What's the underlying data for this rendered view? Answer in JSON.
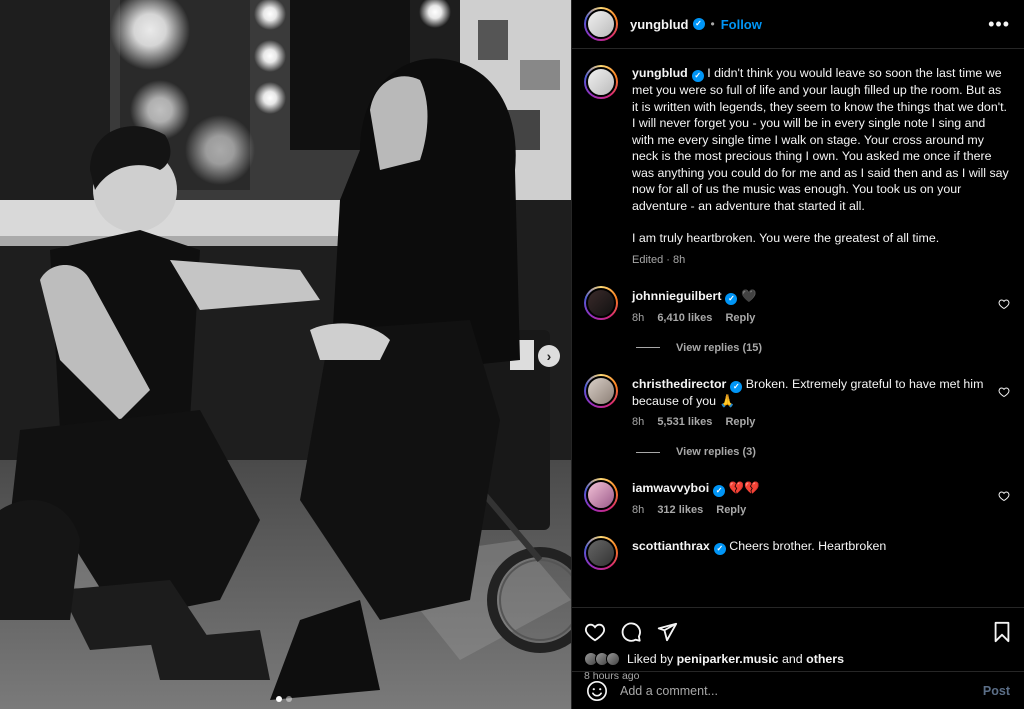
{
  "media": {
    "next_icon": "chevron-right-icon",
    "carousel_count": 2,
    "carousel_active": 1
  },
  "header": {
    "username": "yungblud",
    "separator": "•",
    "follow_label": "Follow",
    "more_icon": "more-horizontal-icon"
  },
  "caption": {
    "username": "yungblud",
    "text": "I didn't think you would leave so soon the last time we met you were so full of life and your laugh filled up the room.  But as it is written with legends, they seem to know the things that we don't. I will never forget you - you will be in every single note I sing and with me every single time I walk on stage. Your cross around my neck is the most precious thing I own. You asked me once if there was anything you could do for me and as I said then and as I will say now for all of us the music was enough. You took us on your adventure - an adventure that started it all.",
    "text2": "I am truly heartbroken. You were the greatest of all time.",
    "meta": "Edited · 8h"
  },
  "comments": [
    {
      "username": "johnnieguilbert",
      "text": "🖤",
      "time": "8h",
      "likes": "6,410 likes",
      "reply_label": "Reply",
      "view_replies": "View replies (15)"
    },
    {
      "username": "christhedirector",
      "text": "Broken. Extremely grateful to have met him because of you 🙏",
      "time": "8h",
      "likes": "5,531 likes",
      "reply_label": "Reply",
      "view_replies": "View replies (3)"
    },
    {
      "username": "iamwavvyboi",
      "text": "💔💔",
      "time": "8h",
      "likes": "312 likes",
      "reply_label": "Reply"
    },
    {
      "username": "scottianthrax",
      "text": "Cheers brother. Heartbroken"
    }
  ],
  "actions": {
    "liked_by_prefix": "Liked by",
    "liked_by_user": "peniparker.music",
    "liked_by_and": "and",
    "liked_by_others": "others",
    "timestamp": "8 hours ago"
  },
  "add_comment": {
    "placeholder": "Add a comment...",
    "post_label": "Post"
  }
}
